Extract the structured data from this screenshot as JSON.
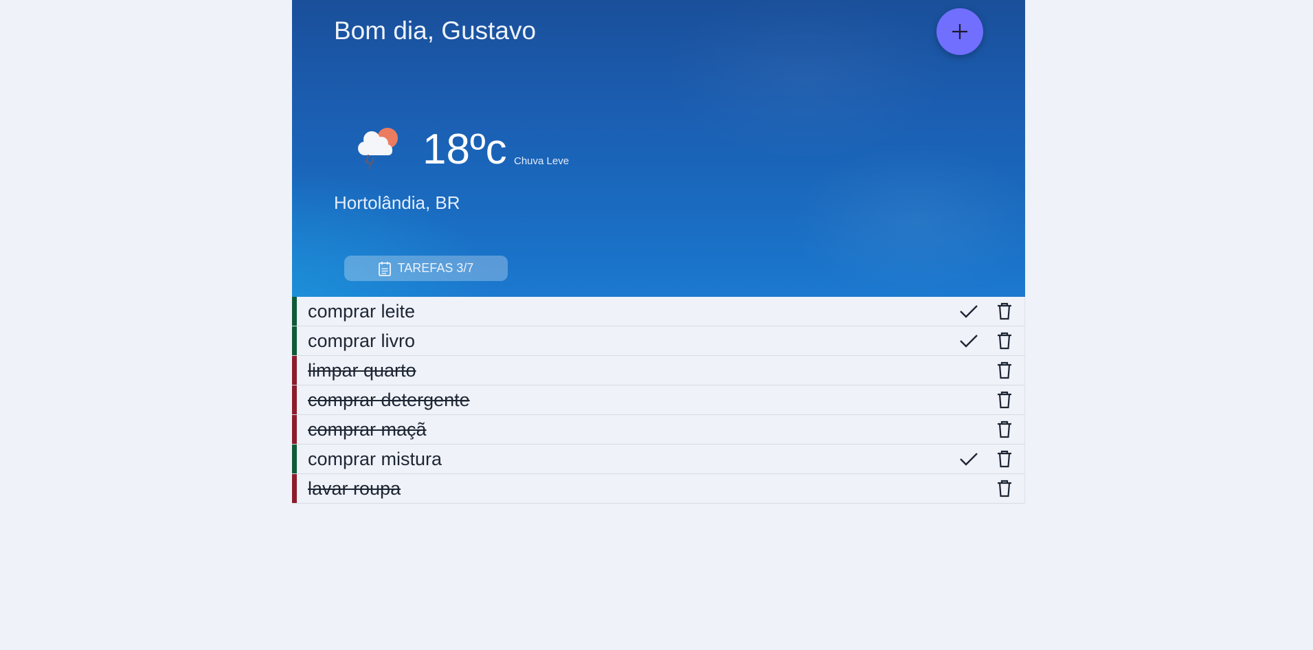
{
  "header": {
    "greeting": "Bom dia, Gustavo",
    "add_button": "add-task"
  },
  "weather": {
    "icon": "cloud-sun-rain-icon",
    "temperature": "18ºc",
    "condition": "Chuva Leve",
    "location": "Hortolândia, BR"
  },
  "tasks_badge": {
    "icon": "clipboard-icon",
    "label": "TAREFAS 3/7"
  },
  "colors": {
    "accent_button": "#716ffd",
    "pending_bar": "#0f5a37",
    "done_bar": "#8c1d2a",
    "background": "#eff2f8"
  },
  "tasks": [
    {
      "label": "comprar leite",
      "completed": false
    },
    {
      "label": "comprar livro",
      "completed": false
    },
    {
      "label": "limpar quarto",
      "completed": true
    },
    {
      "label": "comprar detergente",
      "completed": true
    },
    {
      "label": "comprar maçã",
      "completed": true
    },
    {
      "label": "comprar mistura",
      "completed": false
    },
    {
      "label": "lavar roupa",
      "completed": true
    }
  ]
}
